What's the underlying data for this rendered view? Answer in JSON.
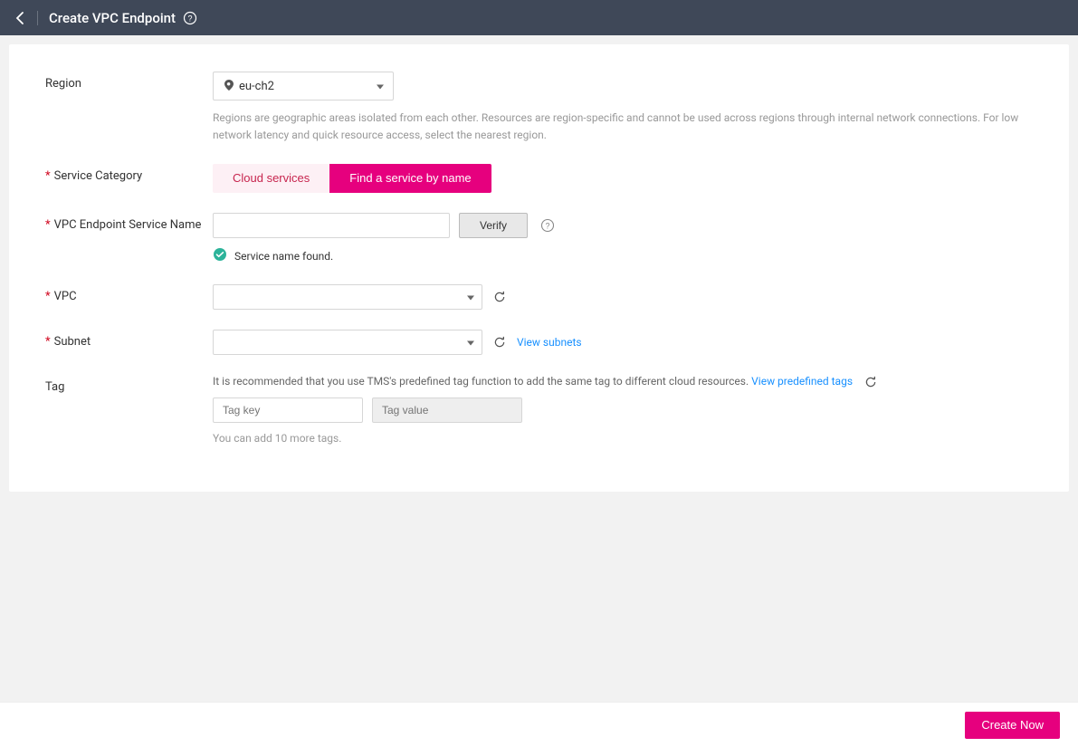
{
  "header": {
    "title": "Create VPC Endpoint"
  },
  "region": {
    "label": "Region",
    "value": "eu-ch2",
    "help": "Regions are geographic areas isolated from each other. Resources are region-specific and cannot be used across regions through internal network connections. For low network latency and quick resource access, select the nearest region."
  },
  "service_category": {
    "label": "Service Category",
    "option_cloud": "Cloud services",
    "option_find": "Find a service by name"
  },
  "endpoint_service_name": {
    "label": "VPC Endpoint Service Name",
    "value": "",
    "verify_label": "Verify",
    "found_msg": "Service name found."
  },
  "vpc": {
    "label": "VPC",
    "value": ""
  },
  "subnet": {
    "label": "Subnet",
    "value": "",
    "view_link": "View subnets"
  },
  "tag": {
    "label": "Tag",
    "hint_prefix": "It is recommended that you use TMS's predefined tag function to add the same tag to different cloud resources. ",
    "predefined_link": "View predefined tags",
    "key_placeholder": "Tag key",
    "value_placeholder": "Tag value",
    "limit_msg": "You can add 10 more tags."
  },
  "footer": {
    "create_label": "Create Now"
  }
}
